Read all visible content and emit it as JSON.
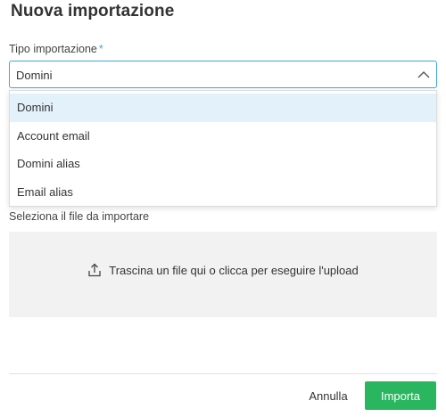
{
  "dialog": {
    "title": "Nuova importazione"
  },
  "import_type": {
    "label": "Tipo importazione",
    "required_mark": "*",
    "selected_value": "Domini",
    "options": [
      "Domini",
      "Account email",
      "Domini alias",
      "Email alias"
    ],
    "selected_index": 0
  },
  "file": {
    "label": "Seleziona il file da importare",
    "dropzone_text": "Trascina un file qui o clicca per eseguire l'upload",
    "icon": "upload-icon"
  },
  "actions": {
    "cancel_label": "Annulla",
    "import_label": "Importa"
  },
  "colors": {
    "accent": "#3aa9d9",
    "primary_button": "#2ab65f",
    "selected_option_bg": "#e3f1fb",
    "dropzone_bg": "#f2f2f2"
  }
}
